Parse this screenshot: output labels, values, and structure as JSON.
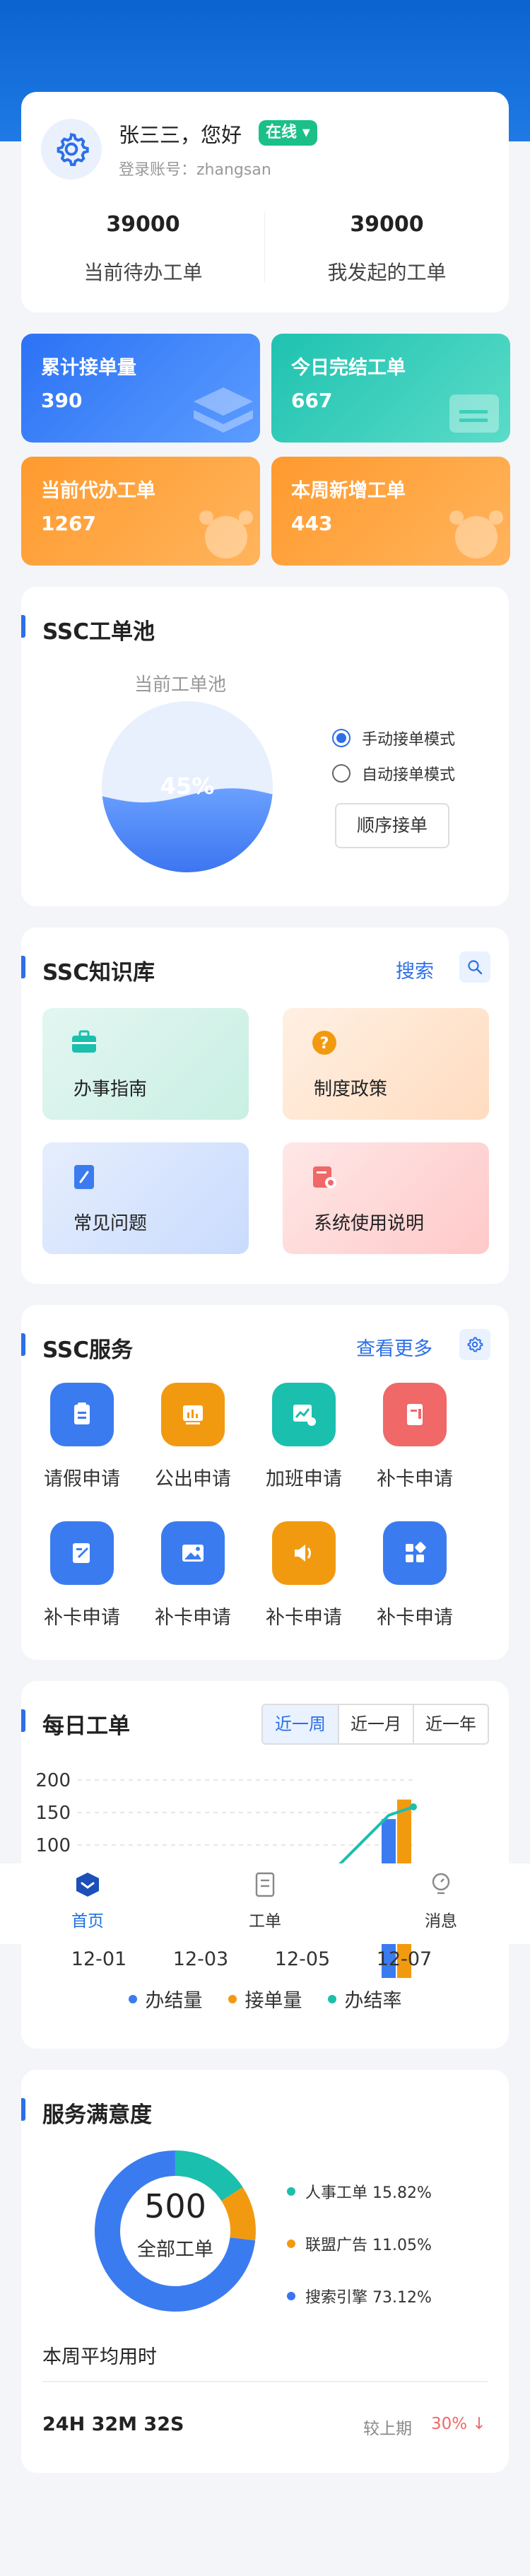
{
  "profile": {
    "name": "张三三，您好",
    "online": "在线",
    "account": "登录账号：zhangsan",
    "stats": [
      {
        "value": "39000",
        "label": "当前待办工单"
      },
      {
        "value": "39000",
        "label": "我发起的工单"
      }
    ]
  },
  "tiles": [
    {
      "title": "累计接单量",
      "value": "390",
      "color": "blue"
    },
    {
      "title": "今日完结工单",
      "value": "667",
      "color": "teal"
    },
    {
      "title": "当前代办工单",
      "value": "1267",
      "color": "orange"
    },
    {
      "title": "本周新增工单",
      "value": "443",
      "color": "orange"
    }
  ],
  "pool": {
    "title": "SSC工单池",
    "chart_label": "当前工单池",
    "percent": "45%",
    "percent_value": 45,
    "options": [
      "手动接单模式",
      "自动接单模式"
    ],
    "selected": 0,
    "button": "顺序接单"
  },
  "knowledge": {
    "title": "SSC知识库",
    "search": "搜索",
    "items": [
      "办事指南",
      "制度政策",
      "常见问题",
      "系统使用说明"
    ]
  },
  "services": {
    "title": "SSC服务",
    "more": "查看更多",
    "items": [
      {
        "label": "请假申请",
        "color": "#3b7bf0",
        "icon": "clipboard-icon"
      },
      {
        "label": "公出申请",
        "color": "#f29a0f",
        "icon": "chart-board-icon"
      },
      {
        "label": "加班申请",
        "color": "#1bbfae",
        "icon": "trend-coins-icon"
      },
      {
        "label": "补卡申请",
        "color": "#f06868",
        "icon": "document-icon"
      },
      {
        "label": "补卡申请",
        "color": "#3b7bf0",
        "icon": "edit-icon"
      },
      {
        "label": "补卡申请",
        "color": "#3b7bf0",
        "icon": "image-icon"
      },
      {
        "label": "补卡申请",
        "color": "#f29a0f",
        "icon": "speaker-icon"
      },
      {
        "label": "补卡申请",
        "color": "#3b7bf0",
        "icon": "grid-icon"
      }
    ]
  },
  "daily": {
    "title": "每日工单",
    "tabs": [
      "近一周",
      "近一月",
      "近一年"
    ],
    "active_tab": 0,
    "legend": [
      {
        "name": "办结量",
        "color": "#3b7bf0"
      },
      {
        "name": "接单量",
        "color": "#f29a0f"
      },
      {
        "name": "办结率",
        "color": "#1bbfae"
      }
    ]
  },
  "chart_data": {
    "type": "bar",
    "categories": [
      "12-01",
      "12-03",
      "12-05",
      "12-07"
    ],
    "yticks": [
      "200",
      "150",
      "100"
    ],
    "ylim": [
      100,
      200
    ],
    "series": [
      {
        "name": "办结量",
        "values": [
          null,
          null,
          null,
          140
        ]
      },
      {
        "name": "接单量",
        "values": [
          null,
          null,
          null,
          170
        ]
      },
      {
        "name": "办结率",
        "values": [
          null,
          null,
          null,
          165
        ]
      }
    ]
  },
  "tabbar": [
    {
      "label": "首页",
      "active": true
    },
    {
      "label": "工单",
      "active": false
    },
    {
      "label": "消息",
      "active": false
    }
  ],
  "satisfaction": {
    "title": "服务满意度",
    "center_value": "500",
    "center_label": "全部工单",
    "items": [
      {
        "label": "人事工单 15.82%",
        "pct": 15.82,
        "color": "#1bbfae"
      },
      {
        "label": "联盟广告 11.05%",
        "pct": 11.05,
        "color": "#f29a0f"
      },
      {
        "label": "搜索引擎 73.12%",
        "pct": 73.12,
        "color": "#3b7bf0"
      }
    ],
    "avg_label": "本周平均用时",
    "avg_value": "24H 32M 32S",
    "compare_label": "较上期",
    "compare_value": "30% ↓"
  }
}
